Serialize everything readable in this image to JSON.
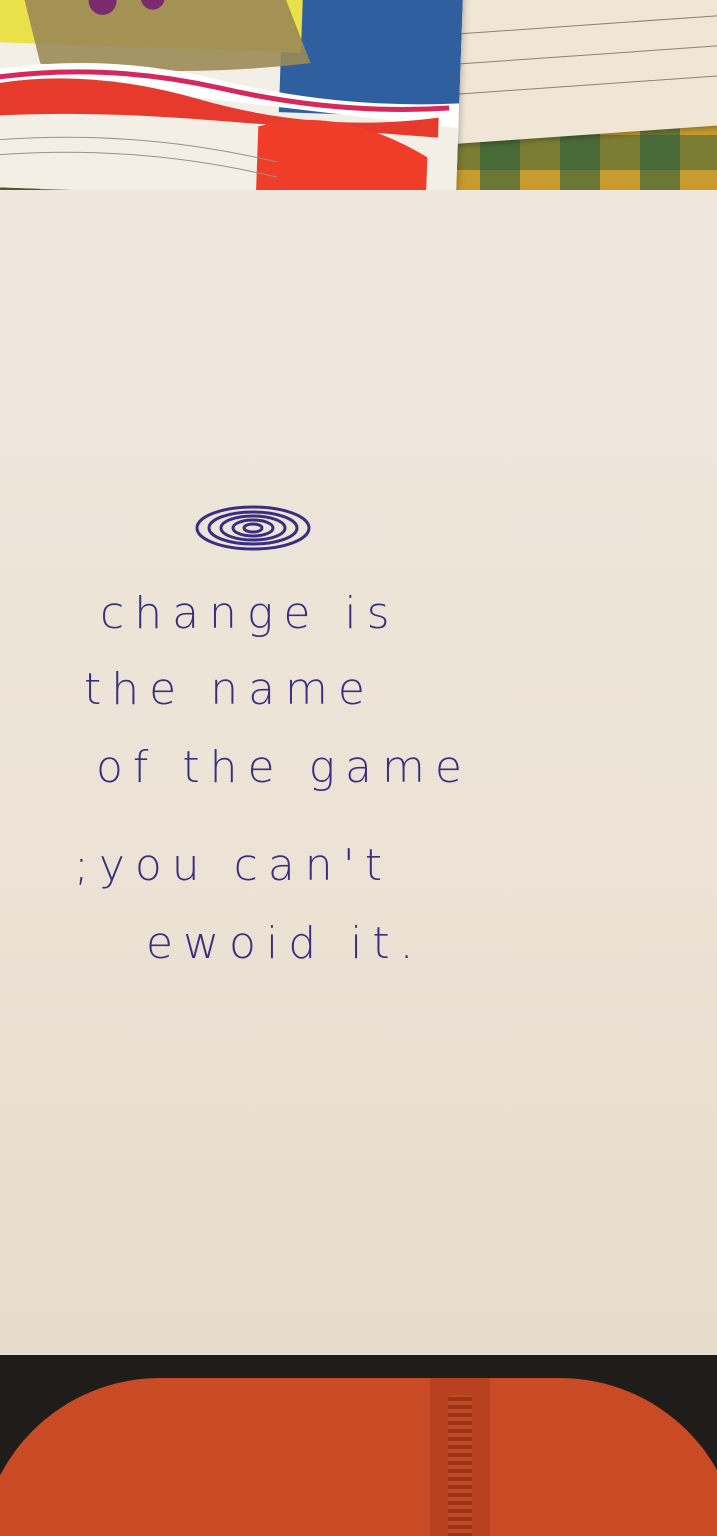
{
  "handwritten_note": {
    "lines": [
      "change is",
      "the name",
      "of the game",
      ";you can't",
      "ewoid it."
    ]
  },
  "colors": {
    "ink": "#3b2e80",
    "paper": "#eee6da",
    "garment": "#c84b26"
  }
}
